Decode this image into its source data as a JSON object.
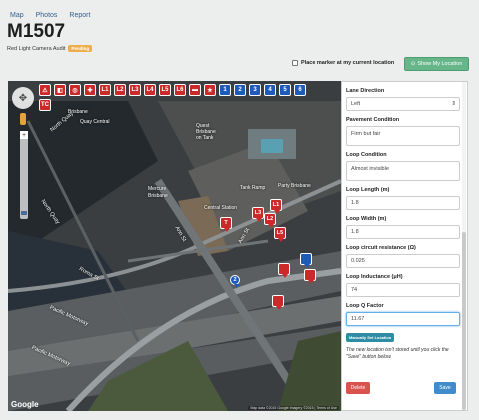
{
  "nav": {
    "items": [
      "Map",
      "Photos",
      "Report"
    ]
  },
  "page": {
    "title": "M1507",
    "subtitle": "Red Light Camera Audit",
    "status_badge": "Pending"
  },
  "controls": {
    "place_marker_label": "Place marker at my current location",
    "show_location_label": "Show My Location",
    "show_location_icon": "target-icon"
  },
  "map": {
    "toolbar_red_icons": [
      "warning-sign-icon",
      "camera-icon",
      "speed-sign-icon",
      "cross-sign-icon"
    ],
    "toolbar_loop_labels": [
      "L1",
      "L2",
      "L3",
      "L4",
      "L5",
      "L6"
    ],
    "toolbar_other_red": [
      "ped-icon",
      "star-icon"
    ],
    "toolbar_blue_labels": [
      "1",
      "2",
      "3",
      "4",
      "5",
      "6"
    ],
    "tc_label": "TC",
    "labels": {
      "north_quay_top": "North Quay",
      "north_quay_mid": "North Quay",
      "brisbane_bank": "Brisbane",
      "quay_central": "Quay Central",
      "mercure": "Mercure",
      "mercure_sub": "Brisbane",
      "quest": "Quest",
      "quest_sub": "Brisbane",
      "quest_sub2": "on Tank",
      "tank_ramp": "Tank Ramp",
      "central_station": "Central Station",
      "ann_st": "Ann St",
      "ann_st2": "Ann St",
      "pacific_motorway": "Pacific Motorway",
      "pacific_motorway2": "Pacific Motorway",
      "party_brisbane": "Party Brisbane",
      "roma_st": "Roma St"
    },
    "pins": [
      {
        "label": "T",
        "color": "red"
      },
      {
        "label": "L3",
        "color": "red"
      },
      {
        "label": "L2",
        "color": "red"
      },
      {
        "label": "L5",
        "color": "red"
      },
      {
        "label": "L1",
        "color": "red"
      },
      {
        "label": "",
        "color": "red"
      },
      {
        "label": "",
        "color": "blue"
      },
      {
        "label": "",
        "color": "red"
      },
      {
        "label": "",
        "color": "red"
      },
      {
        "label": "2",
        "color": "blue"
      }
    ],
    "google_logo": "Google",
    "footer": "Map data ©2015 Google Imagery ©2015 | Terms of Use"
  },
  "form": {
    "lane_direction": {
      "label": "Lane Direction",
      "value": "Left"
    },
    "pavement_condition": {
      "label": "Pavement Condition",
      "value": "Firm but fair"
    },
    "loop_condition": {
      "label": "Loop Condition",
      "value": "Almost invisible"
    },
    "loop_length": {
      "label": "Loop Length (m)",
      "value": "1.8"
    },
    "loop_width": {
      "label": "Loop Width (m)",
      "value": "1.8"
    },
    "loop_circuit_resistance": {
      "label": "Loop circuit resistance (Ω)",
      "value": "0.025"
    },
    "loop_inductance": {
      "label": "Loop Inductance (μH)",
      "value": "74"
    },
    "loop_q_factor": {
      "label": "Loop Q Factor",
      "value": "11.67"
    },
    "manual_set_location": "Manually Set Location",
    "note": "The new location isn't stored until you click the \"Save\" button below.",
    "delete_label": "Delete",
    "save_label": "Save"
  }
}
